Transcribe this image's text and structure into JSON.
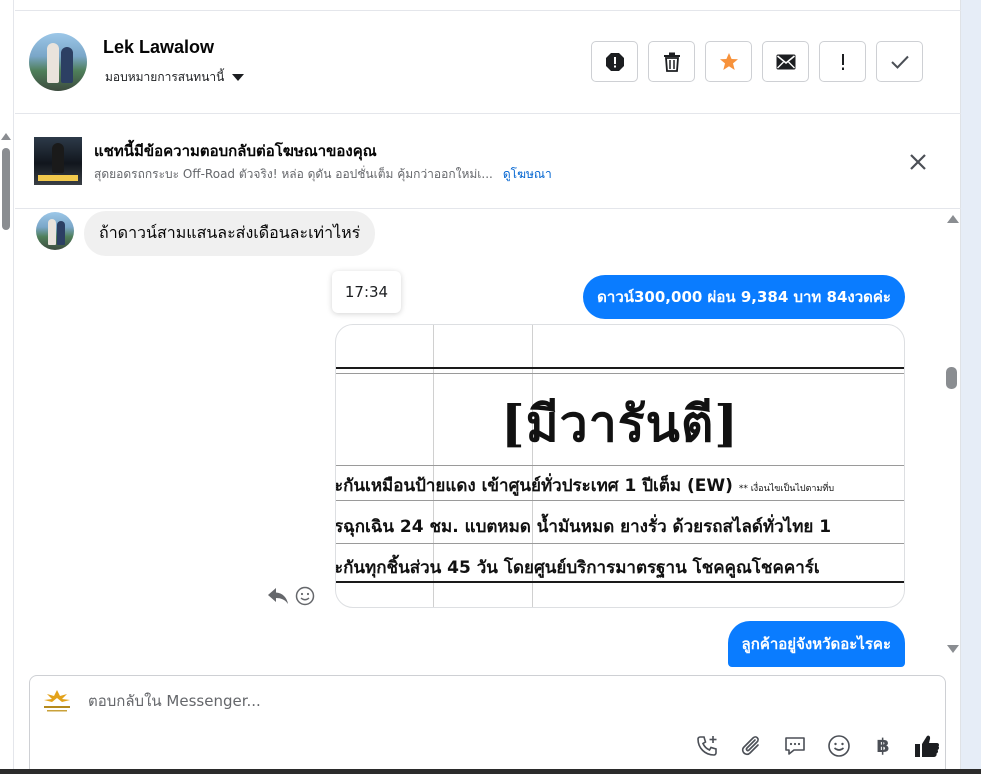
{
  "contact": {
    "name": "Lek Lawalow",
    "assign_label": "มอบหมายการสนทนานี้"
  },
  "toolbar": {
    "buttons": [
      {
        "name": "spam-button",
        "icon": "alert-octagon-icon"
      },
      {
        "name": "delete-button",
        "icon": "trash-icon"
      },
      {
        "name": "star-button",
        "icon": "star-icon",
        "color": "#f7923b"
      },
      {
        "name": "mark-unread-button",
        "icon": "envelope-icon"
      },
      {
        "name": "follow-up-button",
        "icon": "exclamation-icon"
      },
      {
        "name": "mark-done-button",
        "icon": "check-icon"
      }
    ]
  },
  "ad_banner": {
    "title": "แชทนี้มีข้อความตอบกลับต่อโฆษณาของคุณ",
    "description": "สุดยอดรถกระบะ Off-Road ตัวจริง! หล่อ ดุดัน ออปชั่นเต็ม คุ้มกว่าออกใหม่เ...",
    "link": "ดูโฆษณา"
  },
  "messages": {
    "incoming_1": "ถ้าดาวน์สามแสนละส่งเดือนละเท่าไหร่",
    "timestamp": "17:34",
    "outgoing_1": "ดาวน์300,000 ผ่อน 9,384 บาท 84งวดค่ะ",
    "image": {
      "heading": "[มีวารันตี]",
      "line_1": "ะกันเหมือนป้ายแดง เข้าศูนย์ทั่วประเทศ 1 ปีเต็ม (EW)",
      "line_1_note": "** เงื่อนไขเป็นไปตามที่บ",
      "line_2": "รฉุกเฉิน 24 ชม. แบตหมด น้ำมันหมด ยางรั่ว ด้วยรถสไลด์ทั่วไทย 1",
      "line_3": "ะกันทุกชิ้นส่วน 45 วัน โดยศูนย์บริการมาตรฐาน โชคคูณโชคคาร์เ"
    },
    "outgoing_2": "ลูกค้าอยู่จังหวัดอะไรคะ"
  },
  "composer": {
    "placeholder": "ตอบกลับใน Messenger...",
    "tools": [
      {
        "name": "call-button",
        "icon": "phone-plus-icon"
      },
      {
        "name": "attach-button",
        "icon": "paperclip-icon"
      },
      {
        "name": "saved-reply-button",
        "icon": "chat-bubble-icon"
      },
      {
        "name": "emoji-button",
        "icon": "smiley-icon"
      },
      {
        "name": "payment-button",
        "icon": "baht-icon",
        "label": "฿"
      },
      {
        "name": "like-button",
        "icon": "thumbs-up-icon"
      }
    ]
  },
  "colors": {
    "accent": "#0a7cff",
    "link": "#0064d1",
    "star": "#f7923b"
  }
}
